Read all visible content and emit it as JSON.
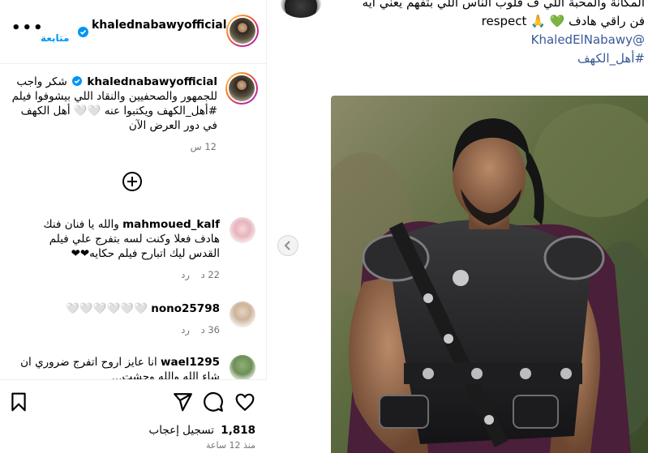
{
  "header": {
    "username": "khalednabawyofficial",
    "follow_label": "متابعة",
    "more_label": "•••"
  },
  "caption": {
    "author": "khalednabawyofficial",
    "text": "شكر واجب للجمهور والصحفيين والنقاد اللي بيشوفوا فيلم #أهل_الكهف ويكتبوا عنه 🤍🤍 أهل الكهف في دور العرض الآن",
    "time": "12 س"
  },
  "caption_tail": {
    "line1": "المكانة والمحبة اللي ف قلوب الناس اللي بتفهم يعني ايه",
    "line2_pre": "فن راقي هادف",
    "line2_post": "respect",
    "line2_emojis": "💚 🙏",
    "mention": "@KhaledElNabawy",
    "hashtag": "#أهل_الكهف"
  },
  "comments": [
    {
      "author": "mahmoued_kalf",
      "text": "والله يا فنان فنك هادف فعلا وكنت لسه بتفرج علي فيلم القدس ليك اتبارح فيلم حكايه❤❤",
      "time": "22 د",
      "reply_label": "رد"
    },
    {
      "author": "nono25798",
      "text": "🤍🤍🤍🤍🤍🤍",
      "time": "36 د",
      "reply_label": "رد"
    },
    {
      "author": "wael1295",
      "text": "انا عايز اروح اتفرج ضروري ان شاء الله والله وحشت...",
      "time": "",
      "reply_label": ""
    }
  ],
  "actions": {
    "likes_count": "1,818",
    "likes_label": "تسجيل إعجاب",
    "post_age": "منذ 12 ساعة"
  },
  "icons": {
    "prev": "chevron-left-icon",
    "load_more": "plus-circle-icon",
    "like": "heart-icon",
    "comment": "comment-icon",
    "share": "paper-plane-icon",
    "save": "bookmark-icon",
    "verified": "verified-badge-icon"
  },
  "colors": {
    "link": "#385898",
    "follow": "#0095f6",
    "verified": "#0095f6",
    "muted": "#737373"
  }
}
